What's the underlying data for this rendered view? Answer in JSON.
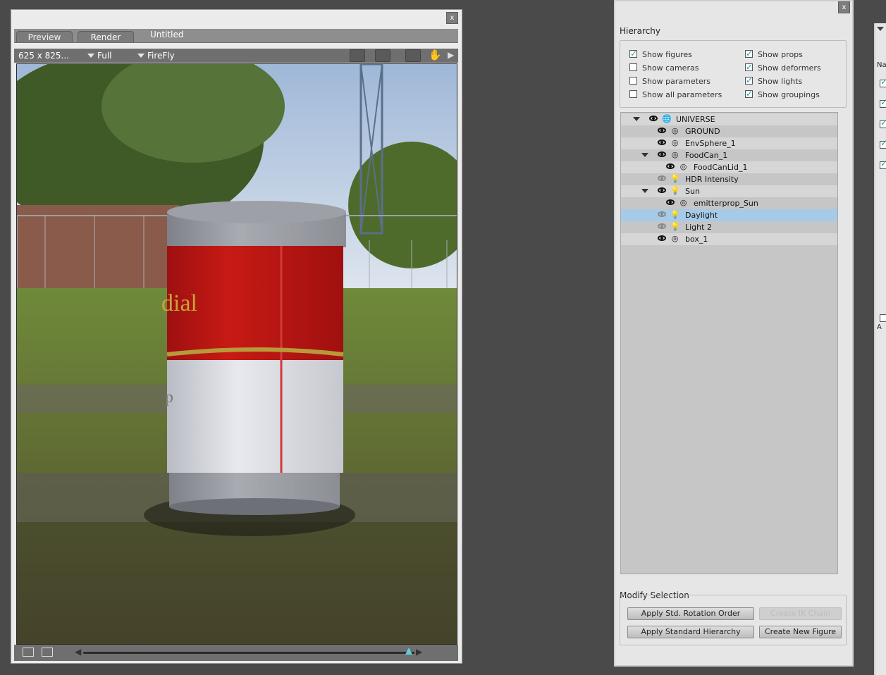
{
  "render_window": {
    "close_label": "x",
    "tabs": [
      "Preview",
      "Render"
    ],
    "document_title": "Untitled",
    "size_label": "625 x 825...",
    "resolution_label": "Full",
    "renderer_label": "FireFly"
  },
  "hierarchy": {
    "close_label": "x",
    "title": "Hierarchy",
    "options": [
      {
        "label": "Show figures",
        "checked": true
      },
      {
        "label": "Show cameras",
        "checked": false
      },
      {
        "label": "Show parameters",
        "checked": false
      },
      {
        "label": "Show all parameters",
        "checked": false
      },
      {
        "label": "Show props",
        "checked": true
      },
      {
        "label": "Show deformers",
        "checked": true
      },
      {
        "label": "Show lights",
        "checked": true
      },
      {
        "label": "Show groupings",
        "checked": true
      }
    ],
    "tree": [
      {
        "label": "UNIVERSE",
        "icon": "globe-icon",
        "expanded": true
      },
      {
        "label": "GROUND",
        "icon": "prop-icon"
      },
      {
        "label": "EnvSphere_1",
        "icon": "prop-icon"
      },
      {
        "label": "FoodCan_1",
        "icon": "prop-icon",
        "expanded": true
      },
      {
        "label": "FoodCanLid_1",
        "icon": "prop-icon"
      },
      {
        "label": "HDR Intensity",
        "icon": "light-bulb-icon",
        "hidden": true
      },
      {
        "label": "Sun",
        "icon": "light-bulb-icon",
        "expanded": true
      },
      {
        "label": "emitterprop_Sun",
        "icon": "prop-icon"
      },
      {
        "label": "Daylight",
        "icon": "light-bulb-icon",
        "hidden": true,
        "selected": true
      },
      {
        "label": "Light 2",
        "icon": "light-bulb-icon",
        "hidden": true
      },
      {
        "label": "box_1",
        "icon": "prop-icon"
      }
    ],
    "modify_title": "Modify Selection",
    "buttons": {
      "apply_rotation": "Apply Std. Rotation Order",
      "create_ik": "Create IK Chain",
      "apply_hierarchy": "Apply Standard Hierarchy",
      "create_figure": "Create New Figure"
    }
  },
  "right_panel": {
    "label_fragment": "Na",
    "label_fragment_2": "A"
  }
}
